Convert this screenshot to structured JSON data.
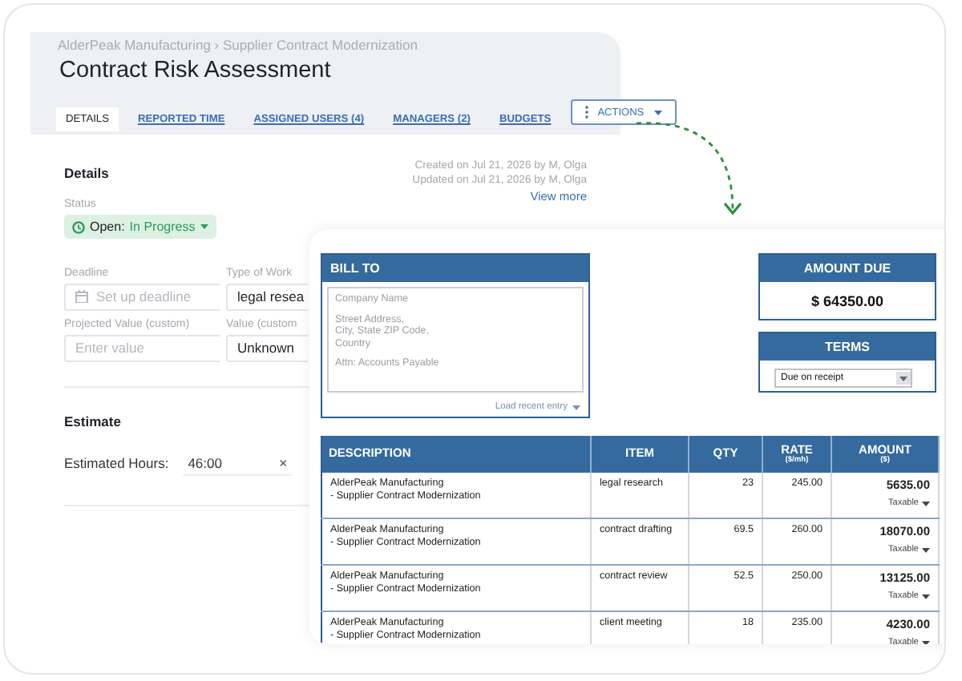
{
  "header": {
    "breadcrumb": "AlderPeak Manufacturing › Supplier Contract Modernization",
    "title": "Contract Risk Assessment",
    "tabs": [
      {
        "label": "DETAILS",
        "selected": true
      },
      {
        "label": "REPORTED TIME",
        "selected": false
      },
      {
        "label": "ASSIGNED USERS (4)",
        "selected": false
      },
      {
        "label": "MANAGERS (2)",
        "selected": false
      },
      {
        "label": "BUDGETS",
        "selected": false
      }
    ],
    "actions_button": "ACTIONS"
  },
  "details": {
    "heading": "Details",
    "meta": [
      "Created on Jul 21, 2026 by M, Olga",
      "Updated on Jul 21, 2026 by M, Olga"
    ],
    "view_more": "View more",
    "status": {
      "label": "Status",
      "state": "Open:",
      "value": "In Progress"
    },
    "fields": [
      {
        "label": "Deadline",
        "kind": "date",
        "placeholder": "Set up deadline"
      },
      {
        "label": "Type of Work",
        "kind": "text",
        "value": "legal resea"
      },
      {
        "label": "Projected Value (custom)",
        "kind": "text",
        "placeholder": "Enter value"
      },
      {
        "label": "Value (custom",
        "kind": "text",
        "value": "Unknown"
      }
    ],
    "estimate": {
      "heading": "Estimate",
      "label": "Estimated Hours:",
      "value": "46:00",
      "clear": "×"
    }
  },
  "invoice": {
    "bill_to": {
      "title": "BILL TO",
      "lines": [
        "Company Name",
        "Street Address,\nCity, State ZIP Code,\nCountry",
        "Attn: Accounts Payable"
      ],
      "load_recent": "Load recent entry"
    },
    "amount_due": {
      "title": "AMOUNT DUE",
      "value": "$ 64350.00"
    },
    "terms": {
      "title": "TERMS",
      "value": "Due on receipt"
    },
    "table": {
      "columns": [
        {
          "title": "DESCRIPTION"
        },
        {
          "title": "ITEM"
        },
        {
          "title": "QTY"
        },
        {
          "title": "RATE",
          "subtitle": "($/mh)"
        },
        {
          "title": "AMOUNT",
          "subtitle": "($)"
        }
      ],
      "rows": [
        {
          "description": "AlderPeak Manufacturing\n- Supplier Contract Modernization",
          "item": "legal research",
          "qty": "23",
          "rate": "245.00",
          "amount": "5635.00",
          "tax": "Taxable"
        },
        {
          "description": "AlderPeak Manufacturing\n- Supplier Contract Modernization",
          "item": "contract drafting",
          "qty": "69.5",
          "rate": "260.00",
          "amount": "18070.00",
          "tax": "Taxable"
        },
        {
          "description": "AlderPeak Manufacturing\n- Supplier Contract Modernization",
          "item": "contract review",
          "qty": "52.5",
          "rate": "250.00",
          "amount": "13125.00",
          "tax": "Taxable"
        },
        {
          "description": "AlderPeak Manufacturing\n- Supplier Contract Modernization",
          "item": "client meeting",
          "qty": "18",
          "rate": "235.00",
          "amount": "4230.00",
          "tax": "Taxable"
        }
      ]
    }
  }
}
